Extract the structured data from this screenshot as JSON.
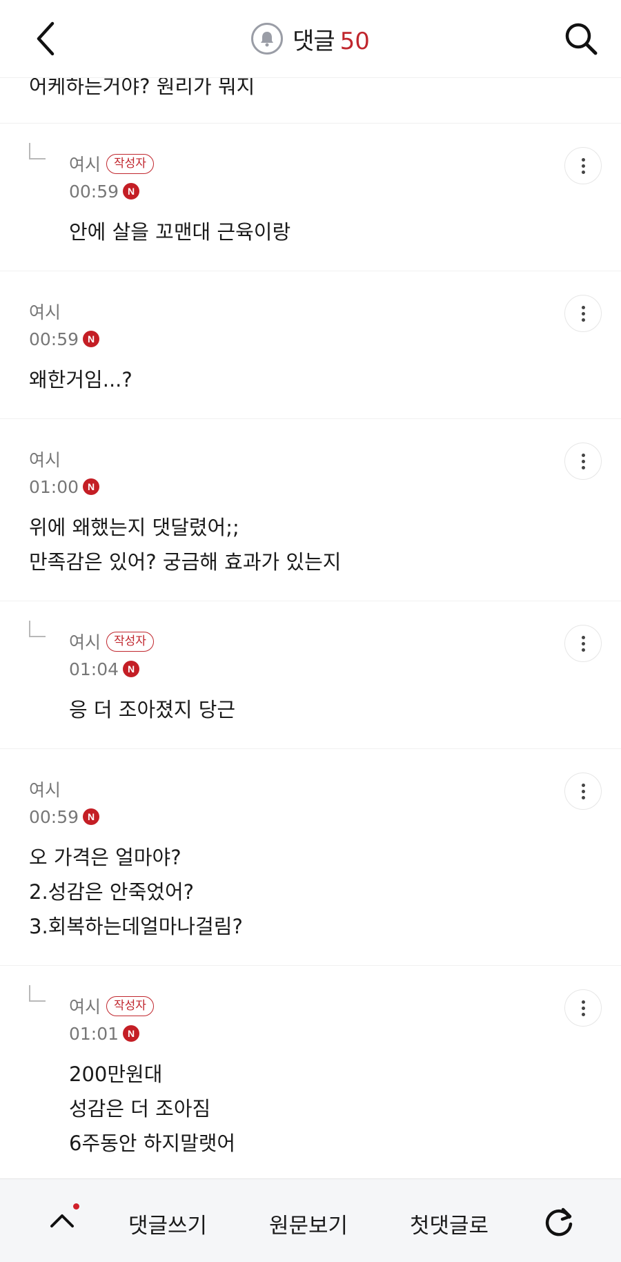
{
  "header": {
    "title": "댓글",
    "count": "50",
    "count_color": "#c0262d",
    "back_icon": "chevron-left-icon",
    "bell_icon": "bell-icon",
    "search_icon": "search-icon"
  },
  "partial_comment": {
    "text": "어케하는거야? 원리가 뭐지"
  },
  "comments": [
    {
      "author": "여시",
      "is_op": true,
      "op_label": "작성자",
      "time": "00:59",
      "new_badge": "N",
      "text": "안에 살을 꼬맨대 근육이랑"
    },
    {
      "author": "여시",
      "is_op": false,
      "op_label": "",
      "time": "00:59",
      "new_badge": "N",
      "text": "왜한거임...?"
    },
    {
      "author": "여시",
      "is_op": false,
      "op_label": "",
      "time": "01:00",
      "new_badge": "N",
      "text": "위에 왜했는지 댓달렸어;;\n만족감은 있어? 궁금해 효과가 있는지"
    },
    {
      "author": "여시",
      "is_op": true,
      "op_label": "작성자",
      "time": "01:04",
      "new_badge": "N",
      "text": "응 더 조아졌지 당근"
    },
    {
      "author": "여시",
      "is_op": false,
      "op_label": "",
      "time": "00:59",
      "new_badge": "N",
      "text": "오 가격은 얼마야?\n2.성감은 안죽었어?\n3.회복하는데얼마나걸림?"
    },
    {
      "author": "여시",
      "is_op": true,
      "op_label": "작성자",
      "time": "01:01",
      "new_badge": "N",
      "text": "200만원대\n성감은 더 조아짐\n6주동안 하지말랫어"
    }
  ],
  "bottom_bar": {
    "write_comment": "댓글쓰기",
    "view_original": "원문보기",
    "first_comment": "첫댓글로",
    "up_icon": "chevron-up-icon",
    "refresh_icon": "refresh-icon",
    "notification_dot_color": "#d0202a"
  }
}
